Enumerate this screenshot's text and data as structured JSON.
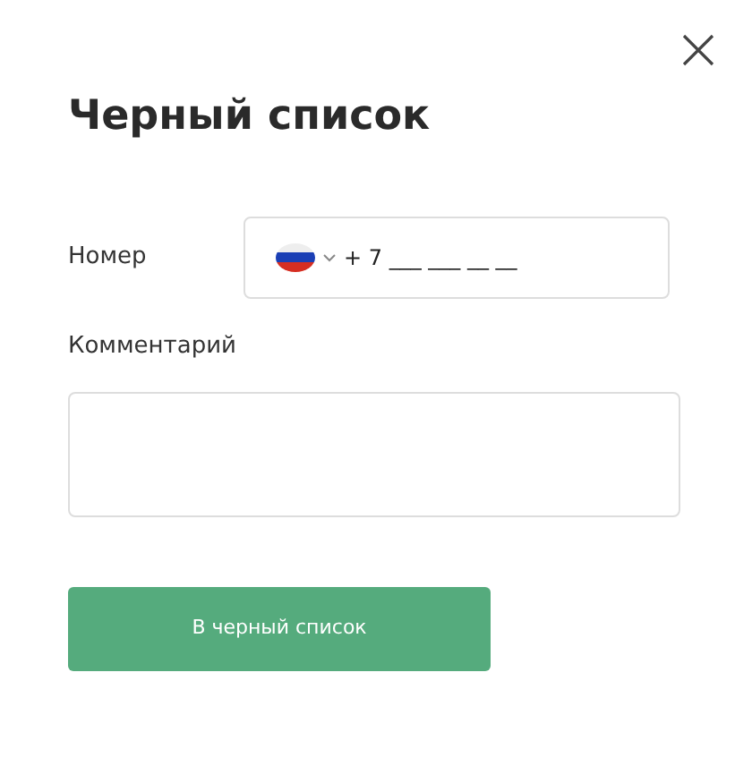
{
  "title": "Черный список",
  "phone": {
    "label": "Номер",
    "value": "+ 7 ___ ___ __ __"
  },
  "comment": {
    "label": "Комментарий"
  },
  "submit": "В черный список"
}
